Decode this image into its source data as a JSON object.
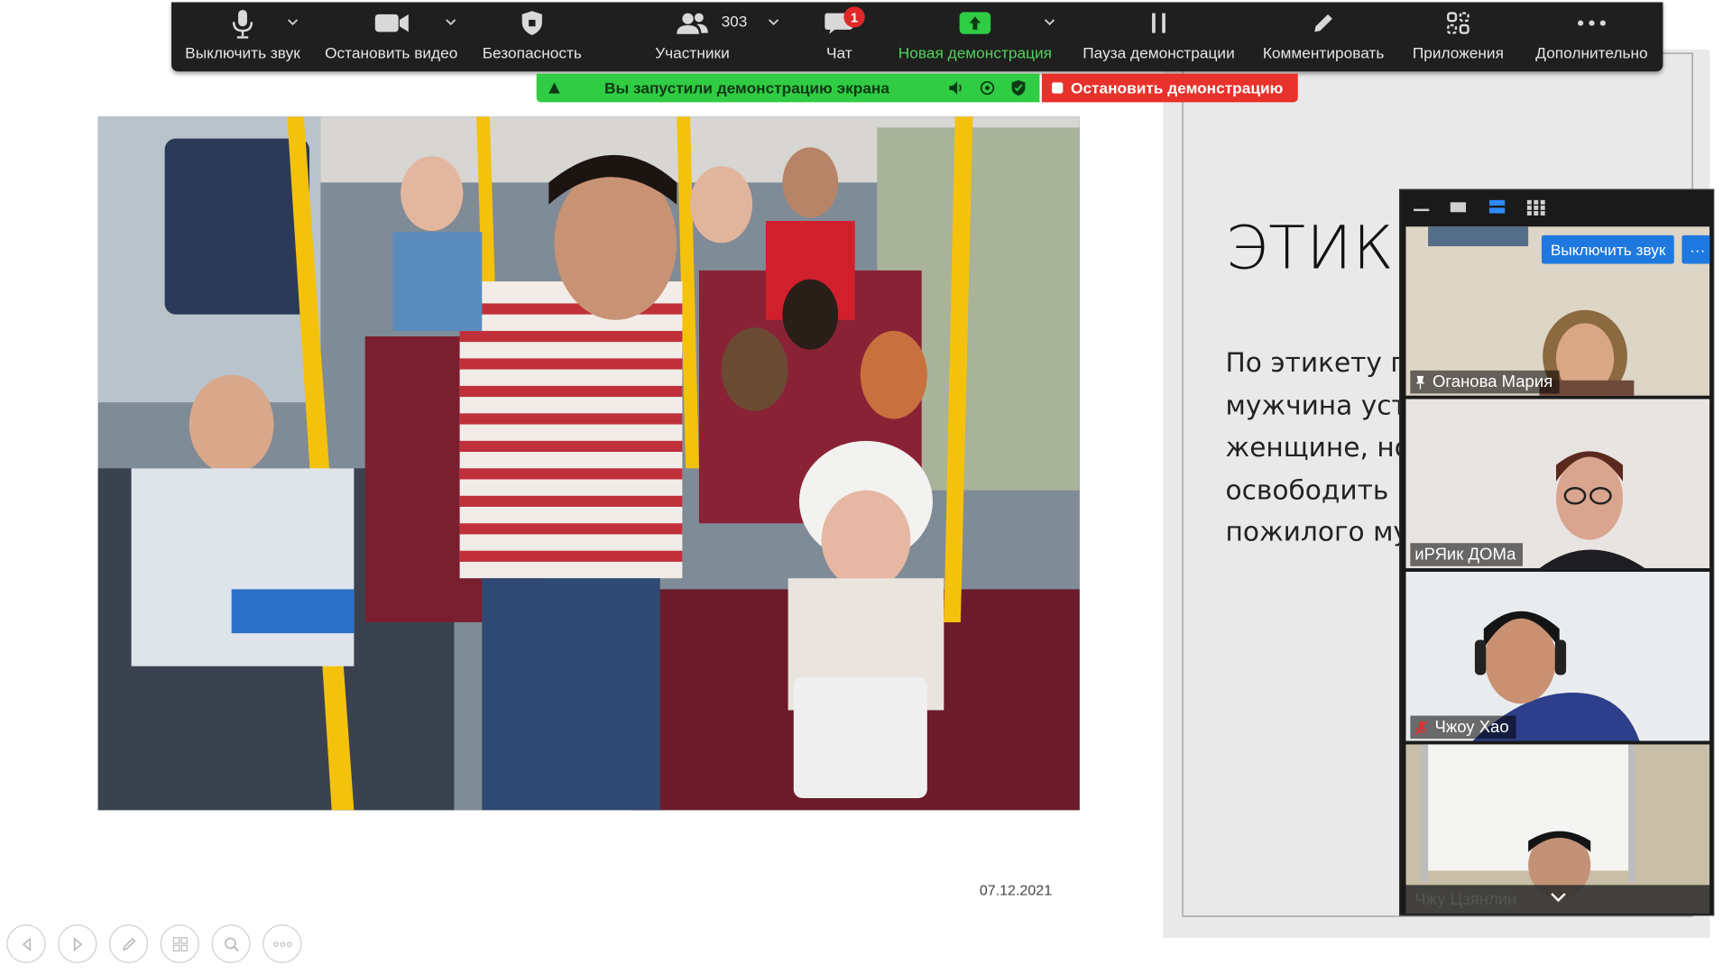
{
  "toolbar": {
    "mute_label": "Выключить звук",
    "stop_video_label": "Остановить видео",
    "security_label": "Безопасность",
    "participants_label": "Участники",
    "participants_count": "303",
    "chat_label": "Чат",
    "chat_badge": "1",
    "new_share_label": "Новая демонстрация",
    "pause_share_label": "Пауза демонстрации",
    "annotate_label": "Комментировать",
    "apps_label": "Приложения",
    "more_label": "Дополнительно"
  },
  "share_banner": {
    "text": "Вы запустили демонстрацию экрана",
    "stop_label": "Остановить демонстрацию"
  },
  "slide": {
    "date": "07.12.2021",
    "heading": "ЭТИКЕ",
    "body_lines": [
      "По этикету п",
      "мужчина уст",
      "женщине, но",
      "освободить",
      "пожилого му"
    ]
  },
  "video_panel": {
    "mute_button_label": "Выключить звук",
    "more_button_label": "···",
    "participants": [
      {
        "name": "Оганова Мария",
        "icon": "pin-icon"
      },
      {
        "name": "иРЯик ДОМа"
      },
      {
        "name": "Чжоу Хао",
        "icon": "muted-mic-icon"
      },
      {
        "name": "Чжу Цзянлин"
      }
    ]
  },
  "colors": {
    "toolbar_bg": "#1f1f1f",
    "share_green": "#2fcc44",
    "stop_red": "#e8312b",
    "accent_blue": "#1e78e0"
  }
}
